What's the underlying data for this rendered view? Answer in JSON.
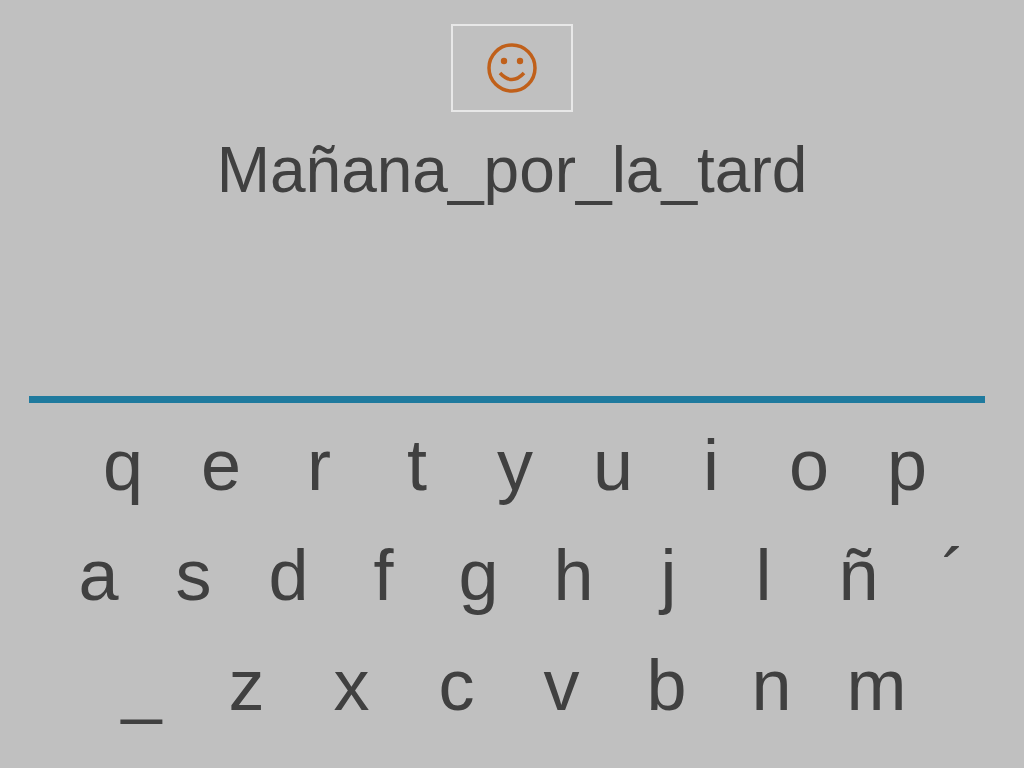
{
  "answer": "Mañana_por_la_tard",
  "keyboard": {
    "rows": [
      [
        "q",
        "e",
        "r",
        "t",
        "y",
        "u",
        "i",
        "o",
        "p"
      ],
      [
        "a",
        "s",
        "d",
        "f",
        "g",
        "h",
        "j",
        "l",
        "ñ",
        "´"
      ],
      [
        "_",
        "z",
        "x",
        "c",
        "v",
        "b",
        "n",
        "m"
      ]
    ]
  }
}
